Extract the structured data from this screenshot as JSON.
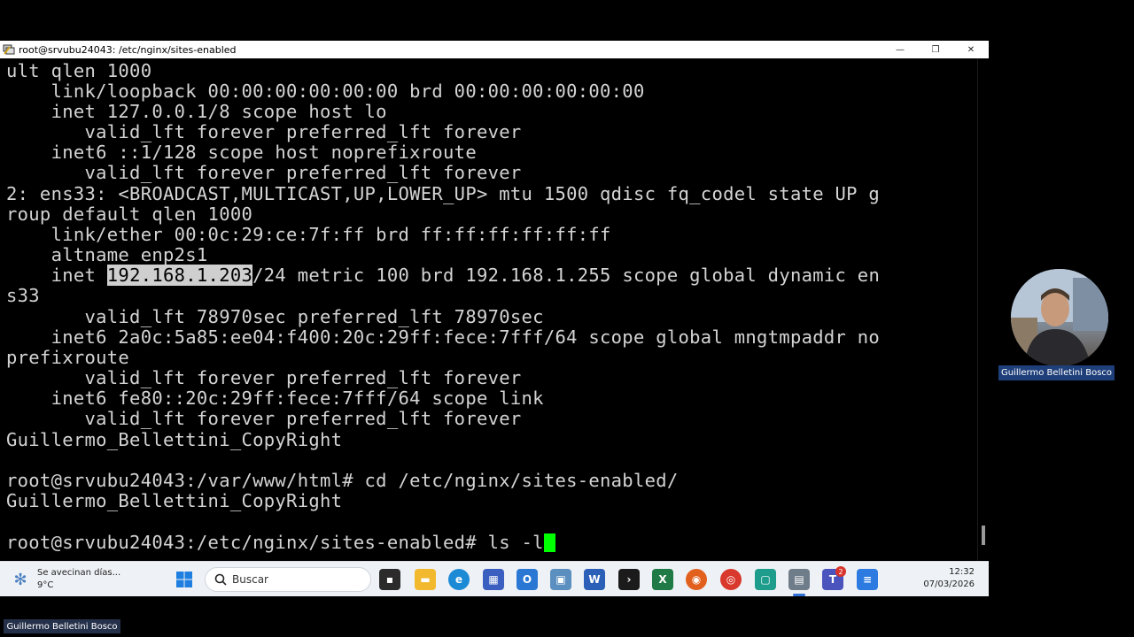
{
  "window": {
    "title": "root@srvubu24043: /etc/nginx/sites-enabled",
    "minimize": "—",
    "maximize": "❐",
    "close": "✕"
  },
  "terminal": {
    "lines": [
      "ult qlen 1000",
      "    link/loopback 00:00:00:00:00:00 brd 00:00:00:00:00:00",
      "    inet 127.0.0.1/8 scope host lo",
      "       valid_lft forever preferred_lft forever",
      "    inet6 ::1/128 scope host noprefixroute",
      "       valid_lft forever preferred_lft forever",
      "2: ens33: <BROADCAST,MULTICAST,UP,LOWER_UP> mtu 1500 qdisc fq_codel state UP g",
      "roup default qlen 1000",
      "    link/ether 00:0c:29:ce:7f:ff brd ff:ff:ff:ff:ff:ff",
      "    altname enp2s1",
      "",
      "s33",
      "       valid_lft 78970sec preferred_lft 78970sec",
      "    inet6 2a0c:5a85:ee04:f400:20c:29ff:fece:7fff/64 scope global mngtmpaddr no",
      "prefixroute",
      "       valid_lft forever preferred_lft forever",
      "    inet6 fe80::20c:29ff:fece:7fff/64 scope link",
      "       valid_lft forever preferred_lft forever",
      "Guillermo_Bellettini_CopyRight",
      "",
      "root@srvubu24043:/var/www/html# cd /etc/nginx/sites-enabled/",
      "Guillermo_Bellettini_CopyRight",
      ""
    ],
    "inet_prefix": "    inet ",
    "inet_selected": "192.168.1.203",
    "inet_suffix": "/24 metric 100 brd 192.168.1.255 scope global dynamic en",
    "prompt": "root@srvubu24043:/etc/nginx/sites-enabled# ",
    "command": "ls -l"
  },
  "taskbar": {
    "weather_line1": "Se avecinan días...",
    "weather_line2": "9°C",
    "search_placeholder": "Buscar",
    "time": "12:32",
    "date": "07/03/2026",
    "teams_badge": "2"
  },
  "presenter": {
    "cam_name": "Guillermo Belletini Bosco",
    "bottom_name": "Guillermo Belletini Bosco"
  }
}
